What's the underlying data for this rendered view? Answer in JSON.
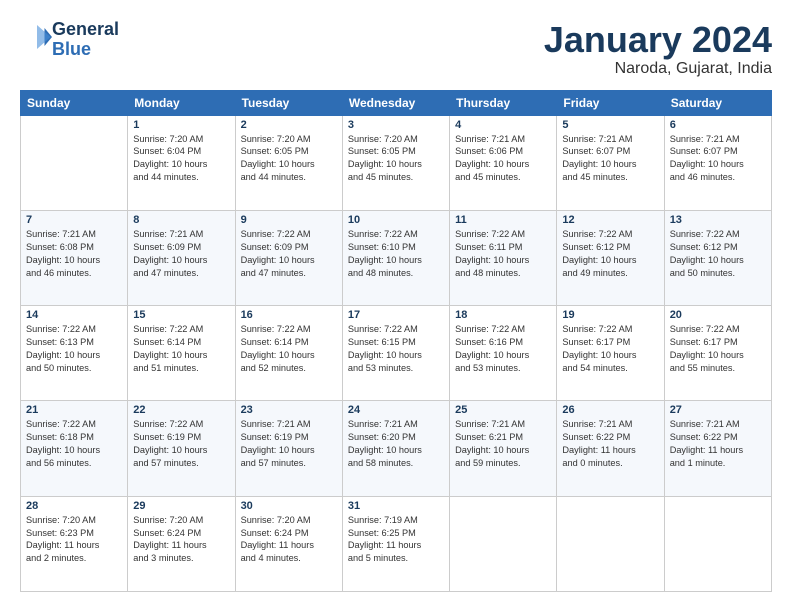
{
  "logo": {
    "text_general": "General",
    "text_blue": "Blue"
  },
  "header": {
    "month_year": "January 2024",
    "location": "Naroda, Gujarat, India"
  },
  "weekdays": [
    "Sunday",
    "Monday",
    "Tuesday",
    "Wednesday",
    "Thursday",
    "Friday",
    "Saturday"
  ],
  "weeks": [
    [
      {
        "day": "",
        "info": ""
      },
      {
        "day": "1",
        "info": "Sunrise: 7:20 AM\nSunset: 6:04 PM\nDaylight: 10 hours\nand 44 minutes."
      },
      {
        "day": "2",
        "info": "Sunrise: 7:20 AM\nSunset: 6:05 PM\nDaylight: 10 hours\nand 44 minutes."
      },
      {
        "day": "3",
        "info": "Sunrise: 7:20 AM\nSunset: 6:05 PM\nDaylight: 10 hours\nand 45 minutes."
      },
      {
        "day": "4",
        "info": "Sunrise: 7:21 AM\nSunset: 6:06 PM\nDaylight: 10 hours\nand 45 minutes."
      },
      {
        "day": "5",
        "info": "Sunrise: 7:21 AM\nSunset: 6:07 PM\nDaylight: 10 hours\nand 45 minutes."
      },
      {
        "day": "6",
        "info": "Sunrise: 7:21 AM\nSunset: 6:07 PM\nDaylight: 10 hours\nand 46 minutes."
      }
    ],
    [
      {
        "day": "7",
        "info": "Sunrise: 7:21 AM\nSunset: 6:08 PM\nDaylight: 10 hours\nand 46 minutes."
      },
      {
        "day": "8",
        "info": "Sunrise: 7:21 AM\nSunset: 6:09 PM\nDaylight: 10 hours\nand 47 minutes."
      },
      {
        "day": "9",
        "info": "Sunrise: 7:22 AM\nSunset: 6:09 PM\nDaylight: 10 hours\nand 47 minutes."
      },
      {
        "day": "10",
        "info": "Sunrise: 7:22 AM\nSunset: 6:10 PM\nDaylight: 10 hours\nand 48 minutes."
      },
      {
        "day": "11",
        "info": "Sunrise: 7:22 AM\nSunset: 6:11 PM\nDaylight: 10 hours\nand 48 minutes."
      },
      {
        "day": "12",
        "info": "Sunrise: 7:22 AM\nSunset: 6:12 PM\nDaylight: 10 hours\nand 49 minutes."
      },
      {
        "day": "13",
        "info": "Sunrise: 7:22 AM\nSunset: 6:12 PM\nDaylight: 10 hours\nand 50 minutes."
      }
    ],
    [
      {
        "day": "14",
        "info": "Sunrise: 7:22 AM\nSunset: 6:13 PM\nDaylight: 10 hours\nand 50 minutes."
      },
      {
        "day": "15",
        "info": "Sunrise: 7:22 AM\nSunset: 6:14 PM\nDaylight: 10 hours\nand 51 minutes."
      },
      {
        "day": "16",
        "info": "Sunrise: 7:22 AM\nSunset: 6:14 PM\nDaylight: 10 hours\nand 52 minutes."
      },
      {
        "day": "17",
        "info": "Sunrise: 7:22 AM\nSunset: 6:15 PM\nDaylight: 10 hours\nand 53 minutes."
      },
      {
        "day": "18",
        "info": "Sunrise: 7:22 AM\nSunset: 6:16 PM\nDaylight: 10 hours\nand 53 minutes."
      },
      {
        "day": "19",
        "info": "Sunrise: 7:22 AM\nSunset: 6:17 PM\nDaylight: 10 hours\nand 54 minutes."
      },
      {
        "day": "20",
        "info": "Sunrise: 7:22 AM\nSunset: 6:17 PM\nDaylight: 10 hours\nand 55 minutes."
      }
    ],
    [
      {
        "day": "21",
        "info": "Sunrise: 7:22 AM\nSunset: 6:18 PM\nDaylight: 10 hours\nand 56 minutes."
      },
      {
        "day": "22",
        "info": "Sunrise: 7:22 AM\nSunset: 6:19 PM\nDaylight: 10 hours\nand 57 minutes."
      },
      {
        "day": "23",
        "info": "Sunrise: 7:21 AM\nSunset: 6:19 PM\nDaylight: 10 hours\nand 57 minutes."
      },
      {
        "day": "24",
        "info": "Sunrise: 7:21 AM\nSunset: 6:20 PM\nDaylight: 10 hours\nand 58 minutes."
      },
      {
        "day": "25",
        "info": "Sunrise: 7:21 AM\nSunset: 6:21 PM\nDaylight: 10 hours\nand 59 minutes."
      },
      {
        "day": "26",
        "info": "Sunrise: 7:21 AM\nSunset: 6:22 PM\nDaylight: 11 hours\nand 0 minutes."
      },
      {
        "day": "27",
        "info": "Sunrise: 7:21 AM\nSunset: 6:22 PM\nDaylight: 11 hours\nand 1 minute."
      }
    ],
    [
      {
        "day": "28",
        "info": "Sunrise: 7:20 AM\nSunset: 6:23 PM\nDaylight: 11 hours\nand 2 minutes."
      },
      {
        "day": "29",
        "info": "Sunrise: 7:20 AM\nSunset: 6:24 PM\nDaylight: 11 hours\nand 3 minutes."
      },
      {
        "day": "30",
        "info": "Sunrise: 7:20 AM\nSunset: 6:24 PM\nDaylight: 11 hours\nand 4 minutes."
      },
      {
        "day": "31",
        "info": "Sunrise: 7:19 AM\nSunset: 6:25 PM\nDaylight: 11 hours\nand 5 minutes."
      },
      {
        "day": "",
        "info": ""
      },
      {
        "day": "",
        "info": ""
      },
      {
        "day": "",
        "info": ""
      }
    ]
  ]
}
